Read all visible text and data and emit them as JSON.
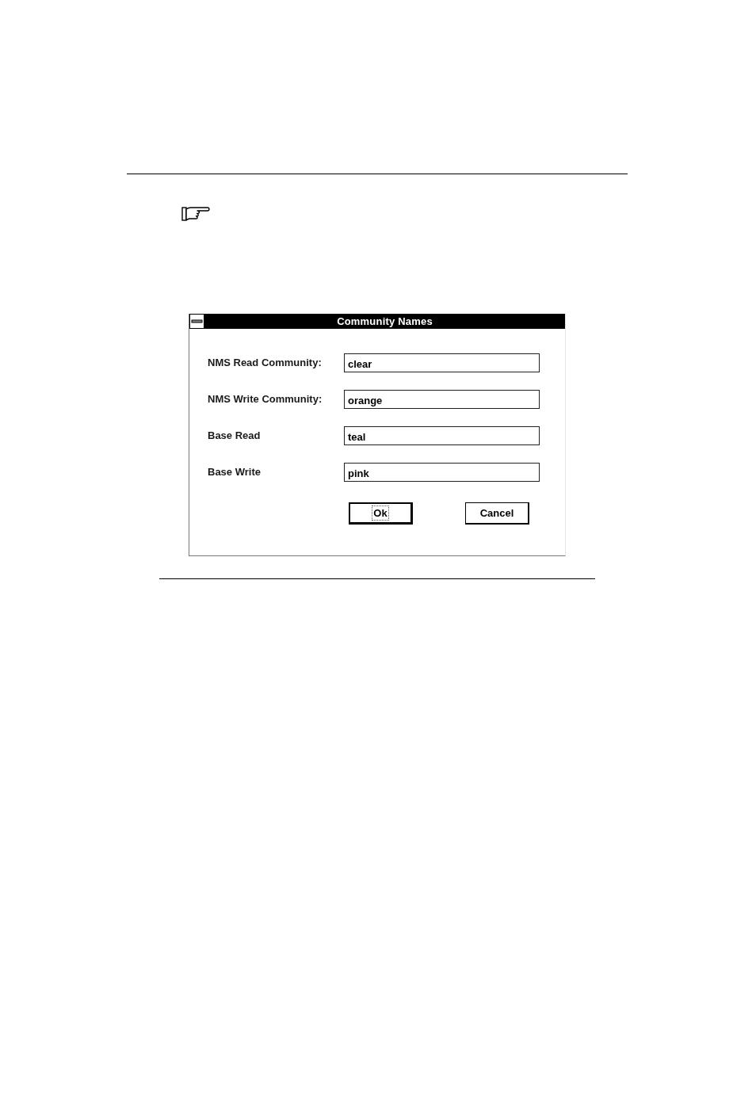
{
  "dialog": {
    "title": "Community Names",
    "fields": [
      {
        "label": "NMS Read Community:",
        "value": "clear"
      },
      {
        "label": "NMS Write Community:",
        "value": "orange"
      },
      {
        "label": "Base Read",
        "value": "teal"
      },
      {
        "label": "Base Write",
        "value": "pink"
      }
    ],
    "buttons": [
      {
        "label": "Ok",
        "default": true,
        "focused": true
      },
      {
        "label": "Cancel",
        "default": false,
        "focused": false
      }
    ]
  }
}
